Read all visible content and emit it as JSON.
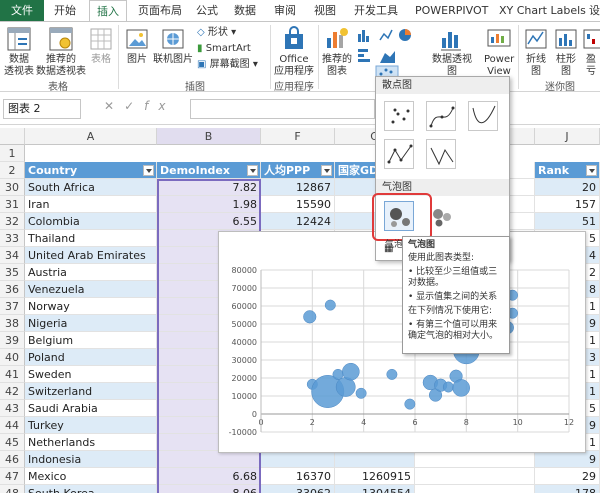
{
  "tabs": {
    "file": "文件",
    "items": [
      "开始",
      "插入",
      "页面布局",
      "公式",
      "数据",
      "审阅",
      "视图",
      "开发工具",
      "POWERPIVOT",
      "XY Chart Labels",
      "设"
    ],
    "active_index": 1
  },
  "ribbon": {
    "pivot_table": "数据\n透视表",
    "recommended_pivot": "推荐的\n数据透视表",
    "table": "表格",
    "picture": "图片",
    "online_picture": "联机图片",
    "shapes": "形状",
    "smartart": "SmartArt",
    "screenshot": "屏幕截图",
    "office_apps": "Office\n应用程序",
    "recommended_charts": "推荐的\n图表",
    "pivot_chart": "数据透视图",
    "power_view": "Power\nView",
    "line_spark": "折线图",
    "column_spark": "柱形图",
    "winloss_spark": "盈亏",
    "groups": {
      "tables": "表格",
      "illustrations": "插图",
      "apps": "应用程序",
      "sparklines": "迷你图"
    }
  },
  "formula_bar": {
    "name_box": "图表 2",
    "cancel": "✕",
    "enter": "✓",
    "fx": "fx"
  },
  "columns": [
    "A",
    "B",
    "F",
    "G",
    "J"
  ],
  "header_row": {
    "row": "2",
    "country": "Country",
    "demo": "DemoIndex",
    "ppp": "人均PPP",
    "gdp": "国家GD",
    "rank": "Rank"
  },
  "rows": [
    {
      "n": "1",
      "country": "",
      "demo": "",
      "ppp": "",
      "gdp": "",
      "rank": ""
    },
    {
      "n": "30",
      "country": "South Africa",
      "demo": "7.82",
      "ppp": "12867",
      "gdp": "3",
      "rank": "20"
    },
    {
      "n": "31",
      "country": "Iran",
      "demo": "1.98",
      "ppp": "15590",
      "gdp": "3",
      "rank": "157"
    },
    {
      "n": "32",
      "country": "Colombia",
      "demo": "6.55",
      "ppp": "12424",
      "gdp": "3",
      "rank": "51"
    },
    {
      "n": "33",
      "country": "Thailand",
      "demo": "",
      "ppp": "",
      "gdp": "",
      "rank": "5"
    },
    {
      "n": "34",
      "country": "United Arab Emirates",
      "demo": "",
      "ppp": "",
      "gdp": "",
      "rank": "4"
    },
    {
      "n": "35",
      "country": "Austria",
      "demo": "",
      "ppp": "",
      "gdp": "",
      "rank": "2"
    },
    {
      "n": "36",
      "country": "Venezuela",
      "demo": "",
      "ppp": "",
      "gdp": "",
      "rank": "8"
    },
    {
      "n": "37",
      "country": "Norway",
      "demo": "",
      "ppp": "",
      "gdp": "",
      "rank": "1"
    },
    {
      "n": "38",
      "country": "Nigeria",
      "demo": "",
      "ppp": "",
      "gdp": "",
      "rank": "9"
    },
    {
      "n": "39",
      "country": "Belgium",
      "demo": "",
      "ppp": "",
      "gdp": "",
      "rank": "1"
    },
    {
      "n": "40",
      "country": "Poland",
      "demo": "",
      "ppp": "",
      "gdp": "",
      "rank": "3"
    },
    {
      "n": "41",
      "country": "Sweden",
      "demo": "",
      "ppp": "",
      "gdp": "",
      "rank": "1"
    },
    {
      "n": "42",
      "country": "Switzerland",
      "demo": "",
      "ppp": "",
      "gdp": "",
      "rank": "1"
    },
    {
      "n": "43",
      "country": "Saudi Arabia",
      "demo": "",
      "ppp": "",
      "gdp": "",
      "rank": "5"
    },
    {
      "n": "44",
      "country": "Turkey",
      "demo": "",
      "ppp": "",
      "gdp": "",
      "rank": "9"
    },
    {
      "n": "45",
      "country": "Netherlands",
      "demo": "",
      "ppp": "",
      "gdp": "",
      "rank": "1"
    },
    {
      "n": "46",
      "country": "Indonesia",
      "demo": "",
      "ppp": "",
      "gdp": "",
      "rank": "9"
    },
    {
      "n": "47",
      "country": "Mexico",
      "demo": "6.68",
      "ppp": "16370",
      "gdp": "1260915",
      "rank": "29"
    },
    {
      "n": "48",
      "country": "South Korea",
      "demo": "8.06",
      "ppp": "33062",
      "gdp": "1304554",
      "rank": "178"
    }
  ],
  "gallery": {
    "scatter_header": "散点图",
    "bubble_header": "气泡图",
    "bubble_label": "气泡图"
  },
  "tooltip": {
    "title": "气泡图",
    "line1": "使用此图表类型:",
    "line2": "• 比较至少三组值或三对数据。",
    "line3": "• 显示值集之间的关系",
    "line4": "在下列情况下使用它:",
    "line5": "• 有第三个值可以用来确定气泡的相对大小。"
  },
  "chart_data": {
    "type": "scatter",
    "xlim": [
      0,
      12
    ],
    "ylim": [
      -10000,
      80000
    ],
    "xticks": [
      0,
      2,
      4,
      6,
      8,
      10,
      12
    ],
    "yticks": [
      -10000,
      0,
      10000,
      20000,
      30000,
      40000,
      50000,
      60000,
      70000,
      80000
    ],
    "xtick_labels": [
      "0",
      "2",
      "4",
      "6",
      "8",
      "10",
      "12"
    ],
    "ytick_labels": [
      "-10000",
      "0",
      "10000",
      "20000",
      "30000",
      "40000",
      "50000",
      "60000",
      "70000",
      "80000"
    ],
    "grid": true,
    "bubble_color": "#5b9bd5",
    "points": [
      {
        "x": 1.9,
        "y": 54000,
        "size": 3
      },
      {
        "x": 2.7,
        "y": 60500,
        "size": 2
      },
      {
        "x": 2.0,
        "y": 16500,
        "size": 2
      },
      {
        "x": 2.6,
        "y": 12500,
        "size": 12
      },
      {
        "x": 3.0,
        "y": 22000,
        "size": 2
      },
      {
        "x": 3.3,
        "y": 15000,
        "size": 6
      },
      {
        "x": 3.5,
        "y": 23500,
        "size": 5
      },
      {
        "x": 3.9,
        "y": 11500,
        "size": 2
      },
      {
        "x": 5.1,
        "y": 22000,
        "size": 2
      },
      {
        "x": 5.8,
        "y": 5500,
        "size": 2
      },
      {
        "x": 6.6,
        "y": 17500,
        "size": 4
      },
      {
        "x": 6.8,
        "y": 10500,
        "size": 3
      },
      {
        "x": 7.0,
        "y": 16000,
        "size": 3
      },
      {
        "x": 7.3,
        "y": 15000,
        "size": 2
      },
      {
        "x": 7.6,
        "y": 21000,
        "size": 3
      },
      {
        "x": 7.8,
        "y": 14500,
        "size": 5
      },
      {
        "x": 8.0,
        "y": 35000,
        "size": 9
      },
      {
        "x": 8.3,
        "y": 40000,
        "size": 3
      },
      {
        "x": 9.6,
        "y": 48000,
        "size": 3
      },
      {
        "x": 9.8,
        "y": 56000,
        "size": 2
      },
      {
        "x": 9.8,
        "y": 66000,
        "size": 2
      }
    ]
  }
}
